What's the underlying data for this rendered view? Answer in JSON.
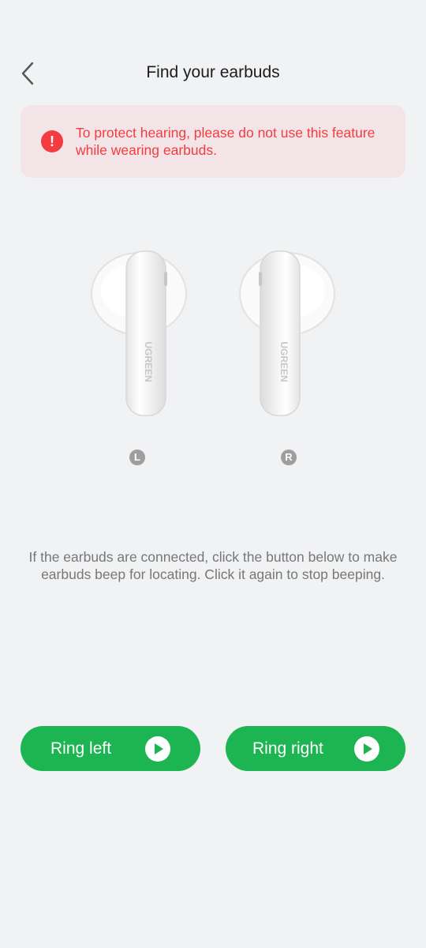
{
  "header": {
    "title": "Find your earbuds",
    "back_icon": "chevron-left-icon"
  },
  "warning": {
    "icon": "exclamation-icon",
    "icon_glyph": "!",
    "text": "To protect hearing, please do not use this feature while wearing earbuds.",
    "color": "#f43b3f",
    "background": "#f3e5e7"
  },
  "earbuds": {
    "brand": "UGREEN",
    "left_label": "L",
    "right_label": "R"
  },
  "instructions": "If the earbuds are connected, click the button below to make earbuds beep for locating. Click it again to stop beeping.",
  "buttons": {
    "ring_left": "Ring left",
    "ring_right": "Ring right",
    "color": "#1db452",
    "icon": "play-icon"
  }
}
